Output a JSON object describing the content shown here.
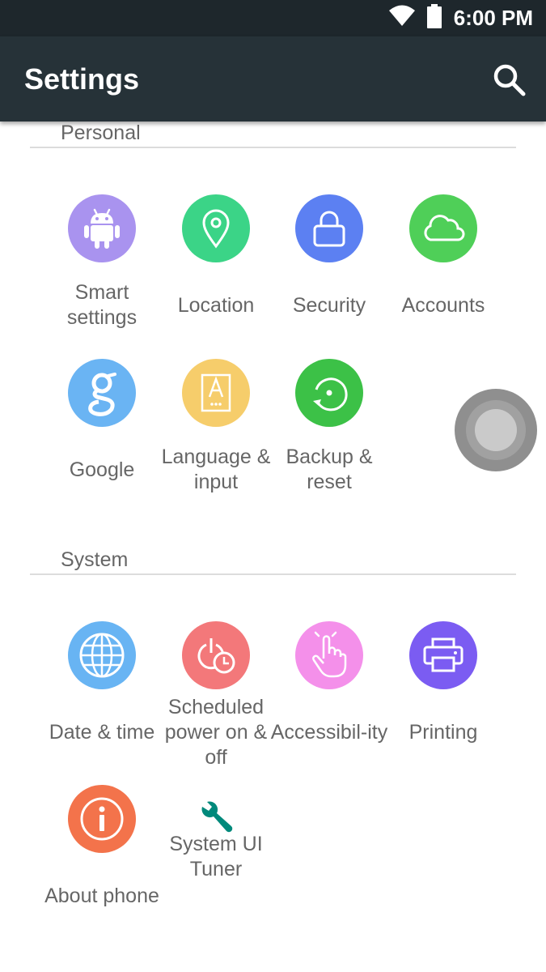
{
  "status_bar": {
    "time": "6:00 PM"
  },
  "app_bar": {
    "title": "Settings"
  },
  "sections": {
    "personal": {
      "title": "Personal",
      "items": [
        {
          "label": "Smart settings",
          "icon": "android-icon",
          "color": "#a993ef"
        },
        {
          "label": "Location",
          "icon": "location-pin-icon",
          "color": "#3bd487"
        },
        {
          "label": "Security",
          "icon": "lock-icon",
          "color": "#5c80f2"
        },
        {
          "label": "Accounts",
          "icon": "cloud-icon",
          "color": "#4fcf58"
        },
        {
          "label": "Google",
          "icon": "google-g-icon",
          "color": "#6ab4f3"
        },
        {
          "label": "Language & input",
          "icon": "language-icon",
          "color": "#f6cd6b"
        },
        {
          "label": "Backup & reset",
          "icon": "backup-icon",
          "color": "#3cc147"
        }
      ]
    },
    "system": {
      "title": "System",
      "items": [
        {
          "label": "Date & time",
          "icon": "globe-icon",
          "color": "#68b4f3"
        },
        {
          "label": "Scheduled power on & off",
          "icon": "scheduled-power-icon",
          "color": "#f3787a"
        },
        {
          "label": "Accessibil-ity",
          "icon": "hand-pointer-icon",
          "color": "#f490ea"
        },
        {
          "label": "Printing",
          "icon": "printer-icon",
          "color": "#7b5cf2"
        },
        {
          "label": "About phone",
          "icon": "info-icon",
          "color": "#f3734b"
        },
        {
          "label": "System UI Tuner",
          "icon": "wrench-icon",
          "color": "#00897b"
        }
      ]
    }
  }
}
